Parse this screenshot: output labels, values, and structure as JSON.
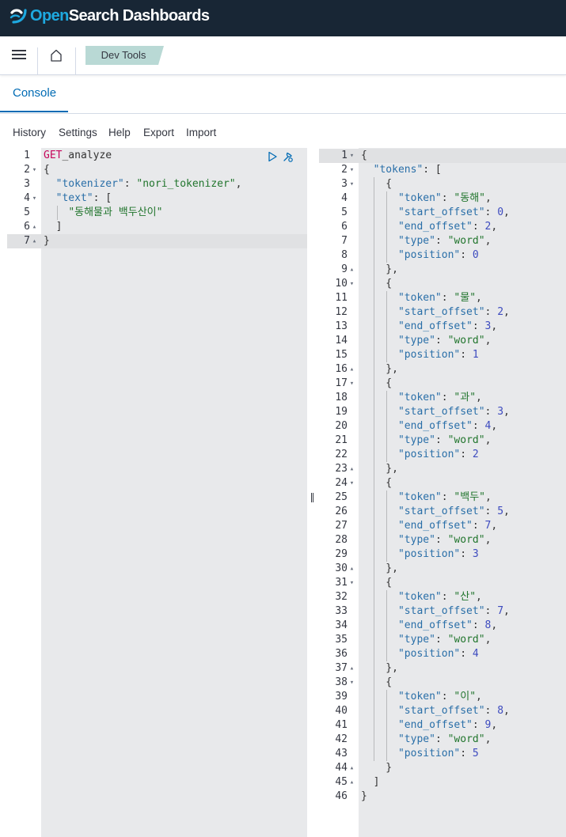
{
  "app": {
    "logo_open": "Open",
    "logo_rest": "Search Dashboards",
    "breadcrumb": "Dev Tools",
    "tab": "Console"
  },
  "menu": [
    "History",
    "Settings",
    "Help",
    "Export",
    "Import"
  ],
  "request": {
    "lines": [
      {
        "num": "1",
        "fold": "",
        "text": [
          [
            "kw",
            "GET"
          ],
          [
            "",
            "_analyze"
          ]
        ]
      },
      {
        "num": "2",
        "fold": "▾",
        "text": [
          [
            "",
            "{"
          ]
        ]
      },
      {
        "num": "3",
        "fold": "",
        "text": [
          [
            "",
            "  "
          ],
          [
            "key",
            "\"tokenizer\""
          ],
          [
            "",
            ": "
          ],
          [
            "str",
            "\"nori_tokenizer\""
          ],
          [
            "",
            ","
          ]
        ]
      },
      {
        "num": "4",
        "fold": "▾",
        "text": [
          [
            "",
            "  "
          ],
          [
            "key",
            "\"text\""
          ],
          [
            "",
            ": ["
          ]
        ]
      },
      {
        "num": "5",
        "fold": "",
        "text": [
          [
            "",
            "    "
          ],
          [
            "str",
            "\"동해물과 백두산이\""
          ]
        ]
      },
      {
        "num": "6",
        "fold": "▴",
        "text": [
          [
            "",
            "  ]"
          ]
        ]
      },
      {
        "num": "7",
        "fold": "▴",
        "text": [
          [
            "",
            "}"
          ]
        ]
      }
    ]
  },
  "response": {
    "lines": [
      {
        "num": "1",
        "fold": "▾",
        "text": [
          [
            "",
            "{"
          ]
        ]
      },
      {
        "num": "2",
        "fold": "▾",
        "text": [
          [
            "",
            "  "
          ],
          [
            "key",
            "\"tokens\""
          ],
          [
            "",
            ": ["
          ]
        ]
      },
      {
        "num": "3",
        "fold": "▾",
        "text": [
          [
            "",
            "    {"
          ]
        ]
      },
      {
        "num": "4",
        "fold": "",
        "text": [
          [
            "",
            "      "
          ],
          [
            "key",
            "\"token\""
          ],
          [
            "",
            ": "
          ],
          [
            "str",
            "\"동해\""
          ],
          [
            "",
            ","
          ]
        ]
      },
      {
        "num": "5",
        "fold": "",
        "text": [
          [
            "",
            "      "
          ],
          [
            "key",
            "\"start_offset\""
          ],
          [
            "",
            ": "
          ],
          [
            "num",
            "0"
          ],
          [
            "",
            ","
          ]
        ]
      },
      {
        "num": "6",
        "fold": "",
        "text": [
          [
            "",
            "      "
          ],
          [
            "key",
            "\"end_offset\""
          ],
          [
            "",
            ": "
          ],
          [
            "num",
            "2"
          ],
          [
            "",
            ","
          ]
        ]
      },
      {
        "num": "7",
        "fold": "",
        "text": [
          [
            "",
            "      "
          ],
          [
            "key",
            "\"type\""
          ],
          [
            "",
            ": "
          ],
          [
            "str",
            "\"word\""
          ],
          [
            "",
            ","
          ]
        ]
      },
      {
        "num": "8",
        "fold": "",
        "text": [
          [
            "",
            "      "
          ],
          [
            "key",
            "\"position\""
          ],
          [
            "",
            ": "
          ],
          [
            "num",
            "0"
          ]
        ]
      },
      {
        "num": "9",
        "fold": "▴",
        "text": [
          [
            "",
            "    },"
          ]
        ]
      },
      {
        "num": "10",
        "fold": "▾",
        "text": [
          [
            "",
            "    {"
          ]
        ]
      },
      {
        "num": "11",
        "fold": "",
        "text": [
          [
            "",
            "      "
          ],
          [
            "key",
            "\"token\""
          ],
          [
            "",
            ": "
          ],
          [
            "str",
            "\"물\""
          ],
          [
            "",
            ","
          ]
        ]
      },
      {
        "num": "12",
        "fold": "",
        "text": [
          [
            "",
            "      "
          ],
          [
            "key",
            "\"start_offset\""
          ],
          [
            "",
            ": "
          ],
          [
            "num",
            "2"
          ],
          [
            "",
            ","
          ]
        ]
      },
      {
        "num": "13",
        "fold": "",
        "text": [
          [
            "",
            "      "
          ],
          [
            "key",
            "\"end_offset\""
          ],
          [
            "",
            ": "
          ],
          [
            "num",
            "3"
          ],
          [
            "",
            ","
          ]
        ]
      },
      {
        "num": "14",
        "fold": "",
        "text": [
          [
            "",
            "      "
          ],
          [
            "key",
            "\"type\""
          ],
          [
            "",
            ": "
          ],
          [
            "str",
            "\"word\""
          ],
          [
            "",
            ","
          ]
        ]
      },
      {
        "num": "15",
        "fold": "",
        "text": [
          [
            "",
            "      "
          ],
          [
            "key",
            "\"position\""
          ],
          [
            "",
            ": "
          ],
          [
            "num",
            "1"
          ]
        ]
      },
      {
        "num": "16",
        "fold": "▴",
        "text": [
          [
            "",
            "    },"
          ]
        ]
      },
      {
        "num": "17",
        "fold": "▾",
        "text": [
          [
            "",
            "    {"
          ]
        ]
      },
      {
        "num": "18",
        "fold": "",
        "text": [
          [
            "",
            "      "
          ],
          [
            "key",
            "\"token\""
          ],
          [
            "",
            ": "
          ],
          [
            "str",
            "\"과\""
          ],
          [
            "",
            ","
          ]
        ]
      },
      {
        "num": "19",
        "fold": "",
        "text": [
          [
            "",
            "      "
          ],
          [
            "key",
            "\"start_offset\""
          ],
          [
            "",
            ": "
          ],
          [
            "num",
            "3"
          ],
          [
            "",
            ","
          ]
        ]
      },
      {
        "num": "20",
        "fold": "",
        "text": [
          [
            "",
            "      "
          ],
          [
            "key",
            "\"end_offset\""
          ],
          [
            "",
            ": "
          ],
          [
            "num",
            "4"
          ],
          [
            "",
            ","
          ]
        ]
      },
      {
        "num": "21",
        "fold": "",
        "text": [
          [
            "",
            "      "
          ],
          [
            "key",
            "\"type\""
          ],
          [
            "",
            ": "
          ],
          [
            "str",
            "\"word\""
          ],
          [
            "",
            ","
          ]
        ]
      },
      {
        "num": "22",
        "fold": "",
        "text": [
          [
            "",
            "      "
          ],
          [
            "key",
            "\"position\""
          ],
          [
            "",
            ": "
          ],
          [
            "num",
            "2"
          ]
        ]
      },
      {
        "num": "23",
        "fold": "▴",
        "text": [
          [
            "",
            "    },"
          ]
        ]
      },
      {
        "num": "24",
        "fold": "▾",
        "text": [
          [
            "",
            "    {"
          ]
        ]
      },
      {
        "num": "25",
        "fold": "",
        "text": [
          [
            "",
            "      "
          ],
          [
            "key",
            "\"token\""
          ],
          [
            "",
            ": "
          ],
          [
            "str",
            "\"백두\""
          ],
          [
            "",
            ","
          ]
        ]
      },
      {
        "num": "26",
        "fold": "",
        "text": [
          [
            "",
            "      "
          ],
          [
            "key",
            "\"start_offset\""
          ],
          [
            "",
            ": "
          ],
          [
            "num",
            "5"
          ],
          [
            "",
            ","
          ]
        ]
      },
      {
        "num": "27",
        "fold": "",
        "text": [
          [
            "",
            "      "
          ],
          [
            "key",
            "\"end_offset\""
          ],
          [
            "",
            ": "
          ],
          [
            "num",
            "7"
          ],
          [
            "",
            ","
          ]
        ]
      },
      {
        "num": "28",
        "fold": "",
        "text": [
          [
            "",
            "      "
          ],
          [
            "key",
            "\"type\""
          ],
          [
            "",
            ": "
          ],
          [
            "str",
            "\"word\""
          ],
          [
            "",
            ","
          ]
        ]
      },
      {
        "num": "29",
        "fold": "",
        "text": [
          [
            "",
            "      "
          ],
          [
            "key",
            "\"position\""
          ],
          [
            "",
            ": "
          ],
          [
            "num",
            "3"
          ]
        ]
      },
      {
        "num": "30",
        "fold": "▴",
        "text": [
          [
            "",
            "    },"
          ]
        ]
      },
      {
        "num": "31",
        "fold": "▾",
        "text": [
          [
            "",
            "    {"
          ]
        ]
      },
      {
        "num": "32",
        "fold": "",
        "text": [
          [
            "",
            "      "
          ],
          [
            "key",
            "\"token\""
          ],
          [
            "",
            ": "
          ],
          [
            "str",
            "\"산\""
          ],
          [
            "",
            ","
          ]
        ]
      },
      {
        "num": "33",
        "fold": "",
        "text": [
          [
            "",
            "      "
          ],
          [
            "key",
            "\"start_offset\""
          ],
          [
            "",
            ": "
          ],
          [
            "num",
            "7"
          ],
          [
            "",
            ","
          ]
        ]
      },
      {
        "num": "34",
        "fold": "",
        "text": [
          [
            "",
            "      "
          ],
          [
            "key",
            "\"end_offset\""
          ],
          [
            "",
            ": "
          ],
          [
            "num",
            "8"
          ],
          [
            "",
            ","
          ]
        ]
      },
      {
        "num": "35",
        "fold": "",
        "text": [
          [
            "",
            "      "
          ],
          [
            "key",
            "\"type\""
          ],
          [
            "",
            ": "
          ],
          [
            "str",
            "\"word\""
          ],
          [
            "",
            ","
          ]
        ]
      },
      {
        "num": "36",
        "fold": "",
        "text": [
          [
            "",
            "      "
          ],
          [
            "key",
            "\"position\""
          ],
          [
            "",
            ": "
          ],
          [
            "num",
            "4"
          ]
        ]
      },
      {
        "num": "37",
        "fold": "▴",
        "text": [
          [
            "",
            "    },"
          ]
        ]
      },
      {
        "num": "38",
        "fold": "▾",
        "text": [
          [
            "",
            "    {"
          ]
        ]
      },
      {
        "num": "39",
        "fold": "",
        "text": [
          [
            "",
            "      "
          ],
          [
            "key",
            "\"token\""
          ],
          [
            "",
            ": "
          ],
          [
            "str",
            "\"이\""
          ],
          [
            "",
            ","
          ]
        ]
      },
      {
        "num": "40",
        "fold": "",
        "text": [
          [
            "",
            "      "
          ],
          [
            "key",
            "\"start_offset\""
          ],
          [
            "",
            ": "
          ],
          [
            "num",
            "8"
          ],
          [
            "",
            ","
          ]
        ]
      },
      {
        "num": "41",
        "fold": "",
        "text": [
          [
            "",
            "      "
          ],
          [
            "key",
            "\"end_offset\""
          ],
          [
            "",
            ": "
          ],
          [
            "num",
            "9"
          ],
          [
            "",
            ","
          ]
        ]
      },
      {
        "num": "42",
        "fold": "",
        "text": [
          [
            "",
            "      "
          ],
          [
            "key",
            "\"type\""
          ],
          [
            "",
            ": "
          ],
          [
            "str",
            "\"word\""
          ],
          [
            "",
            ","
          ]
        ]
      },
      {
        "num": "43",
        "fold": "",
        "text": [
          [
            "",
            "      "
          ],
          [
            "key",
            "\"position\""
          ],
          [
            "",
            ": "
          ],
          [
            "num",
            "5"
          ]
        ]
      },
      {
        "num": "44",
        "fold": "▴",
        "text": [
          [
            "",
            "    }"
          ]
        ]
      },
      {
        "num": "45",
        "fold": "▴",
        "text": [
          [
            "",
            "  ]"
          ]
        ]
      },
      {
        "num": "46",
        "fold": "",
        "text": [
          [
            "",
            "}"
          ]
        ]
      }
    ]
  }
}
